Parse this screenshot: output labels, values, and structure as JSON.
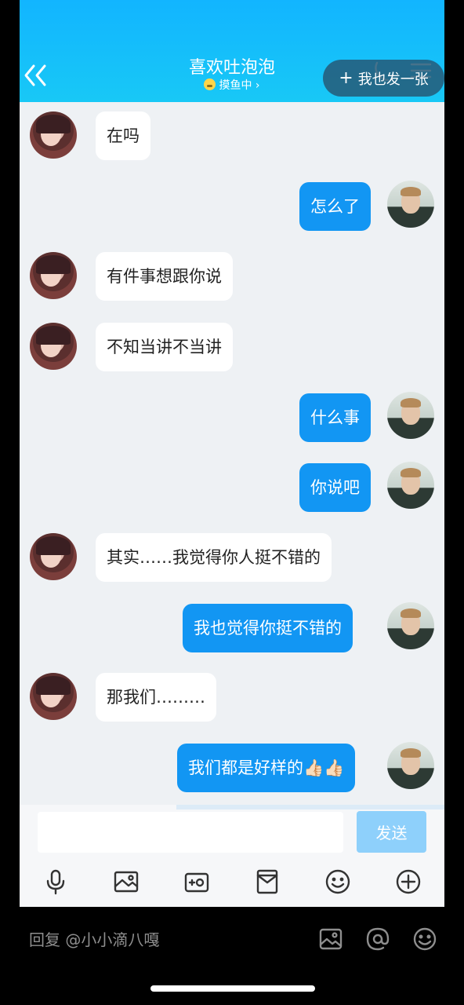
{
  "header": {
    "title": "喜欢吐泡泡",
    "subtitle": "摸鱼中 ›",
    "post_button": "我也发一张"
  },
  "messages": [
    {
      "side": "left",
      "text": "在吗"
    },
    {
      "side": "right",
      "text": "怎么了"
    },
    {
      "side": "left",
      "text": "有件事想跟你说"
    },
    {
      "side": "left",
      "text": "不知当讲不当讲"
    },
    {
      "side": "right",
      "text": "什么事"
    },
    {
      "side": "right",
      "text": "你说吧"
    },
    {
      "side": "left",
      "text": "其实……我觉得你人挺不错的"
    },
    {
      "side": "right",
      "text": "我也觉得你挺不错的"
    },
    {
      "side": "left",
      "text": "那我们………"
    },
    {
      "side": "right",
      "text": "我们都是好样的👍🏻👍🏻"
    }
  ],
  "input": {
    "value": "",
    "send_label": "发送"
  },
  "toolbar": {
    "icons": [
      "microphone-icon",
      "image-icon",
      "camera-icon",
      "red-packet-icon",
      "emoji-icon",
      "plus-icon"
    ]
  },
  "reply_bar": {
    "text": "回复 @小小滴八嘎",
    "icons": [
      "image-icon",
      "at-icon",
      "emoji-icon"
    ]
  },
  "colors": {
    "header": "#12b5ff",
    "bubble_right": "#1296f3",
    "bubble_left": "#ffffff",
    "send_button": "#8ed0fb"
  }
}
